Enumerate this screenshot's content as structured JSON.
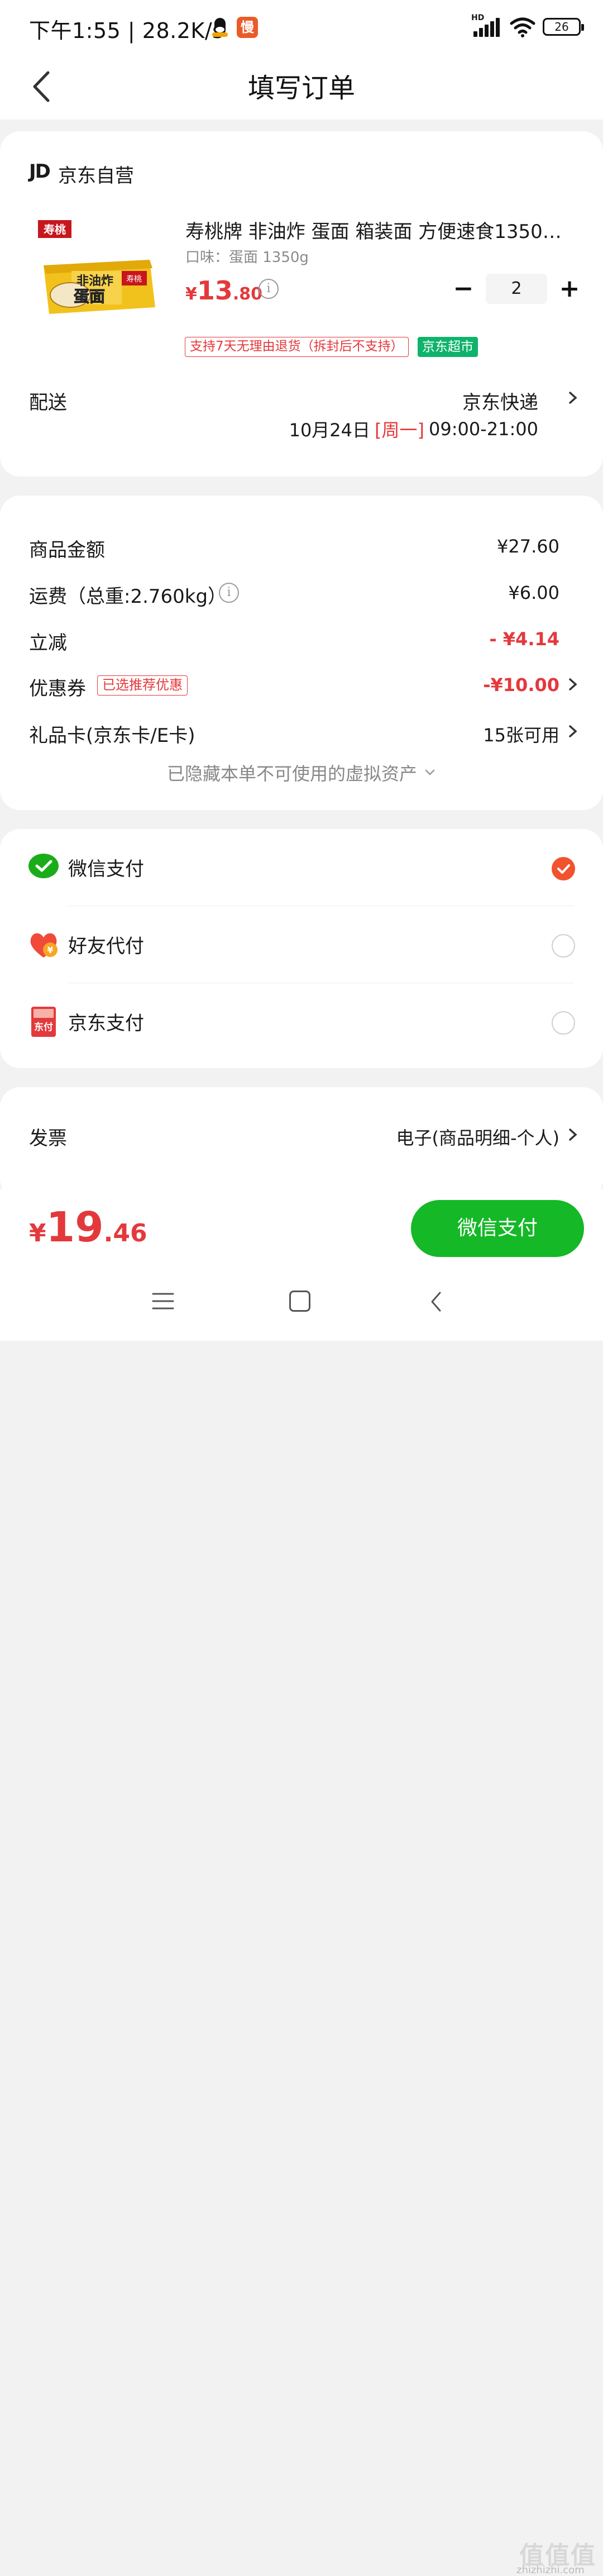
{
  "status_bar": {
    "time_speed": "下午1:55 | 28.2K/s",
    "app_badge": "慢",
    "hd": "HD",
    "battery": "26"
  },
  "header": {
    "title": "填写订单"
  },
  "shop": {
    "logo": "JD",
    "name": "京东自营"
  },
  "product": {
    "title": "寿桃牌 非油炸 蛋面 箱装面 方便速食1350…",
    "spec": "口味：蛋面 1350g",
    "price_currency": "¥",
    "price_int": "13",
    "price_dec": ".80",
    "quantity": "2",
    "tag_return": "支持7天无理由退货（拆封后不支持）",
    "tag_market": "京东超市",
    "image_text": {
      "brand": "寿桃",
      "line1": "非油炸",
      "line2": "蛋面"
    }
  },
  "delivery": {
    "label": "配送",
    "method": "京东快递",
    "date": "10月24日",
    "weekday": "[周一]",
    "time": "09:00-21:00"
  },
  "summary": {
    "goods_label": "商品金额",
    "goods_value": "¥27.60",
    "freight_label": "运费（总重:2.760kg）",
    "freight_value": "¥6.00",
    "discount_label": "立减",
    "discount_value": "- ¥4.14",
    "coupon_label": "优惠券",
    "coupon_tag": "已选推荐优惠",
    "coupon_value": "-¥10.00",
    "giftcard_label": "礼品卡(京东卡/E卡)",
    "giftcard_value": "15张可用",
    "hidden_note": "已隐藏本单不可使用的虚拟资产"
  },
  "payment": {
    "methods": [
      {
        "label": "微信支付",
        "selected": true
      },
      {
        "label": "好友代付",
        "selected": false
      },
      {
        "label": "京东支付",
        "selected": false
      }
    ],
    "jd_icon_text": "东付",
    "friend_icon_text": "¥"
  },
  "invoice": {
    "label": "发票",
    "value": "电子(商品明细-个人)"
  },
  "bottom": {
    "currency": "¥",
    "total_int": "19",
    "total_dec": ".46",
    "pay_button": "微信支付"
  },
  "watermark": {
    "site": "zhizhizhi.com",
    "logo": "值值值"
  },
  "colors": {
    "accent_red": "#e4393c",
    "wechat_green": "#15b827",
    "radio_selected": "#f0532d",
    "market_green": "#0fb36b"
  }
}
